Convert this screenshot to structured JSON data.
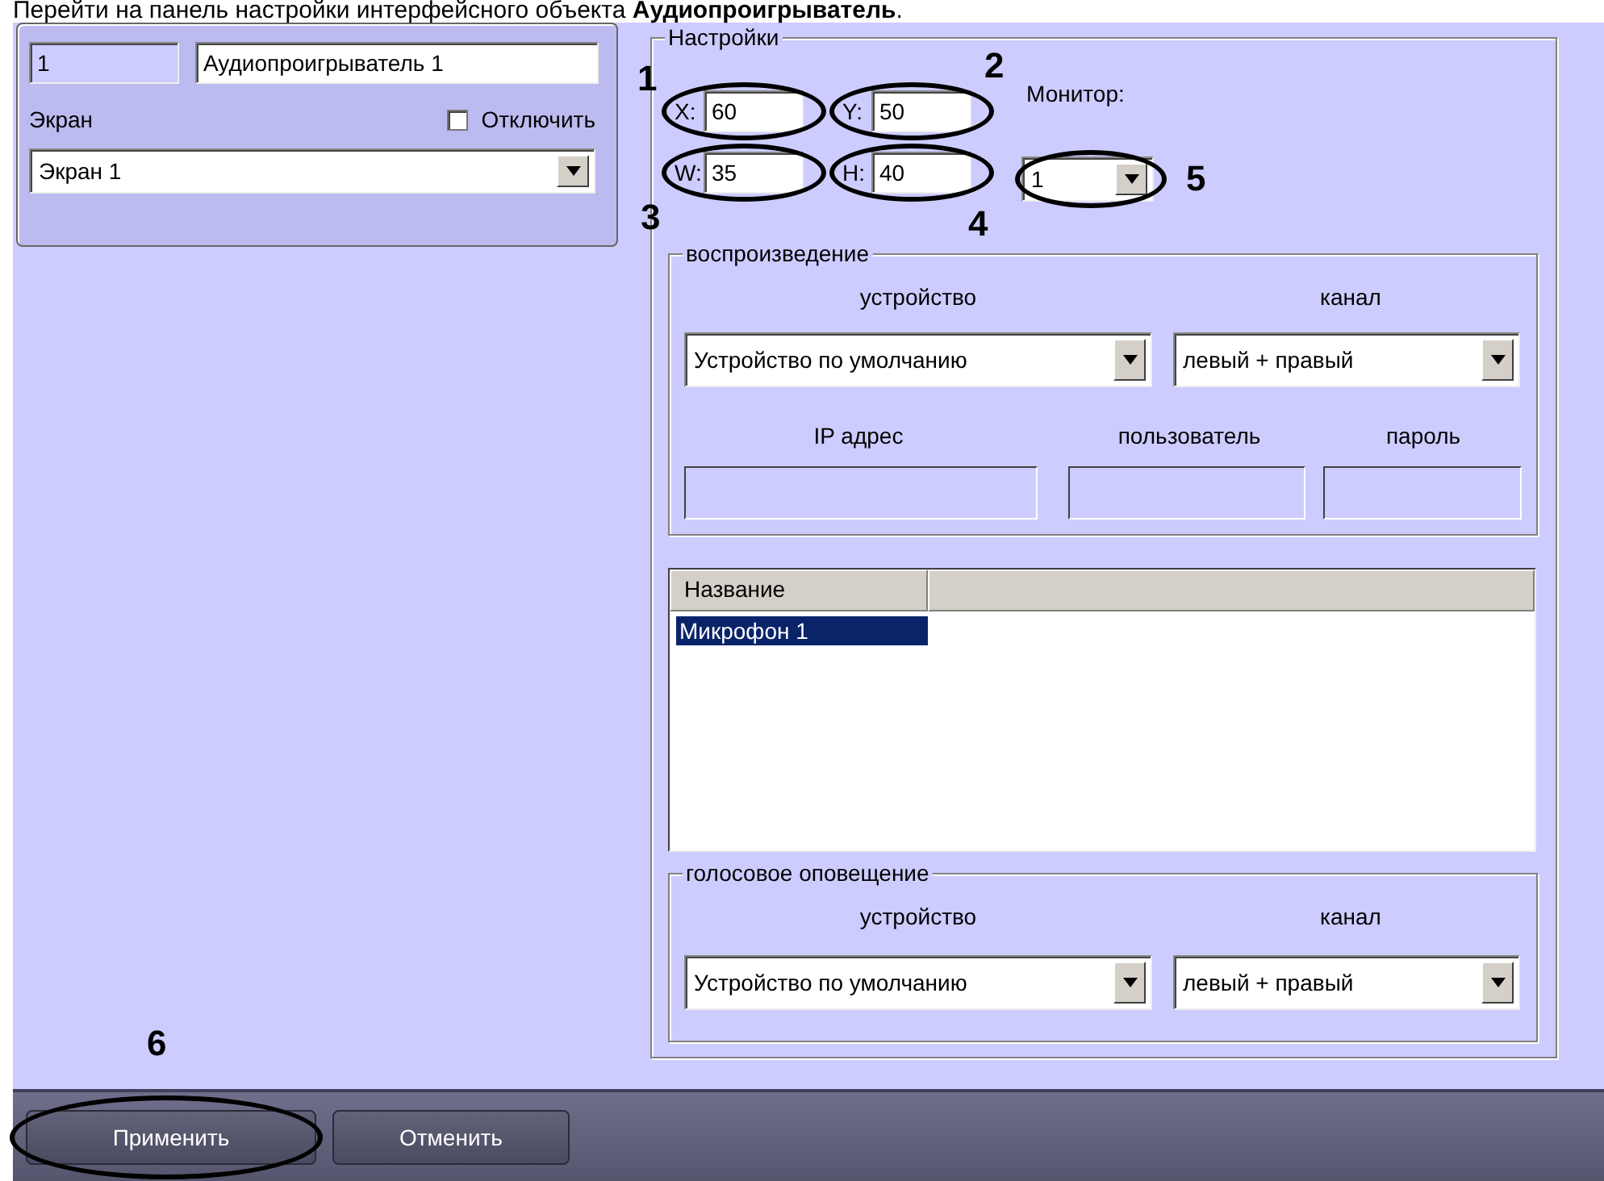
{
  "instruction": "Перейти на панель настройки интерфейсного объекта **Аудиопроигрыватель**.",
  "object_panel": {
    "id_field": {
      "value": "1",
      "disabled": true
    },
    "name_field": {
      "value": "Аудиопроигрыватель 1",
      "disabled": false
    },
    "screen_label": "Экран",
    "disable_checkbox": {
      "label": "Отключить",
      "checked": false
    },
    "screen_combo": {
      "value": "Экран 1"
    }
  },
  "settings": {
    "title": "Настройки",
    "position_fields": [
      {
        "label": "X:",
        "value": "60",
        "callout": "1"
      },
      {
        "label": "Y:",
        "value": "50",
        "callout": "2"
      },
      {
        "label": "W:",
        "value": "35",
        "callout": "3"
      },
      {
        "label": "H:",
        "value": "40",
        "callout": "4"
      }
    ],
    "monitor": {
      "label": "Монитор:",
      "value": "1",
      "callout": "5"
    },
    "playback": {
      "title": "воспроизведение",
      "device_label": "устройство",
      "channel_label": "канал",
      "device_combo": {
        "value": "Устройство по умолчанию"
      },
      "channel_combo": {
        "value": "левый + правый"
      },
      "ip_label": "IP адрес",
      "user_label": "пользователь",
      "password_label": "пароль"
    },
    "microphones": {
      "columns": [
        "Название"
      ],
      "rows": [
        {
          "name": "Микрофон 1",
          "selected": true
        }
      ]
    },
    "voice_alert": {
      "title": "голосовое оповещение",
      "device_label": "устройство",
      "channel_label": "канал",
      "device_combo": {
        "value": "Устройство по умолчанию"
      },
      "channel_combo": {
        "value": "левый + правый"
      }
    }
  },
  "buttons": [
    {
      "label": "Применить",
      "callout": "6"
    },
    {
      "label": "Отменить"
    }
  ]
}
